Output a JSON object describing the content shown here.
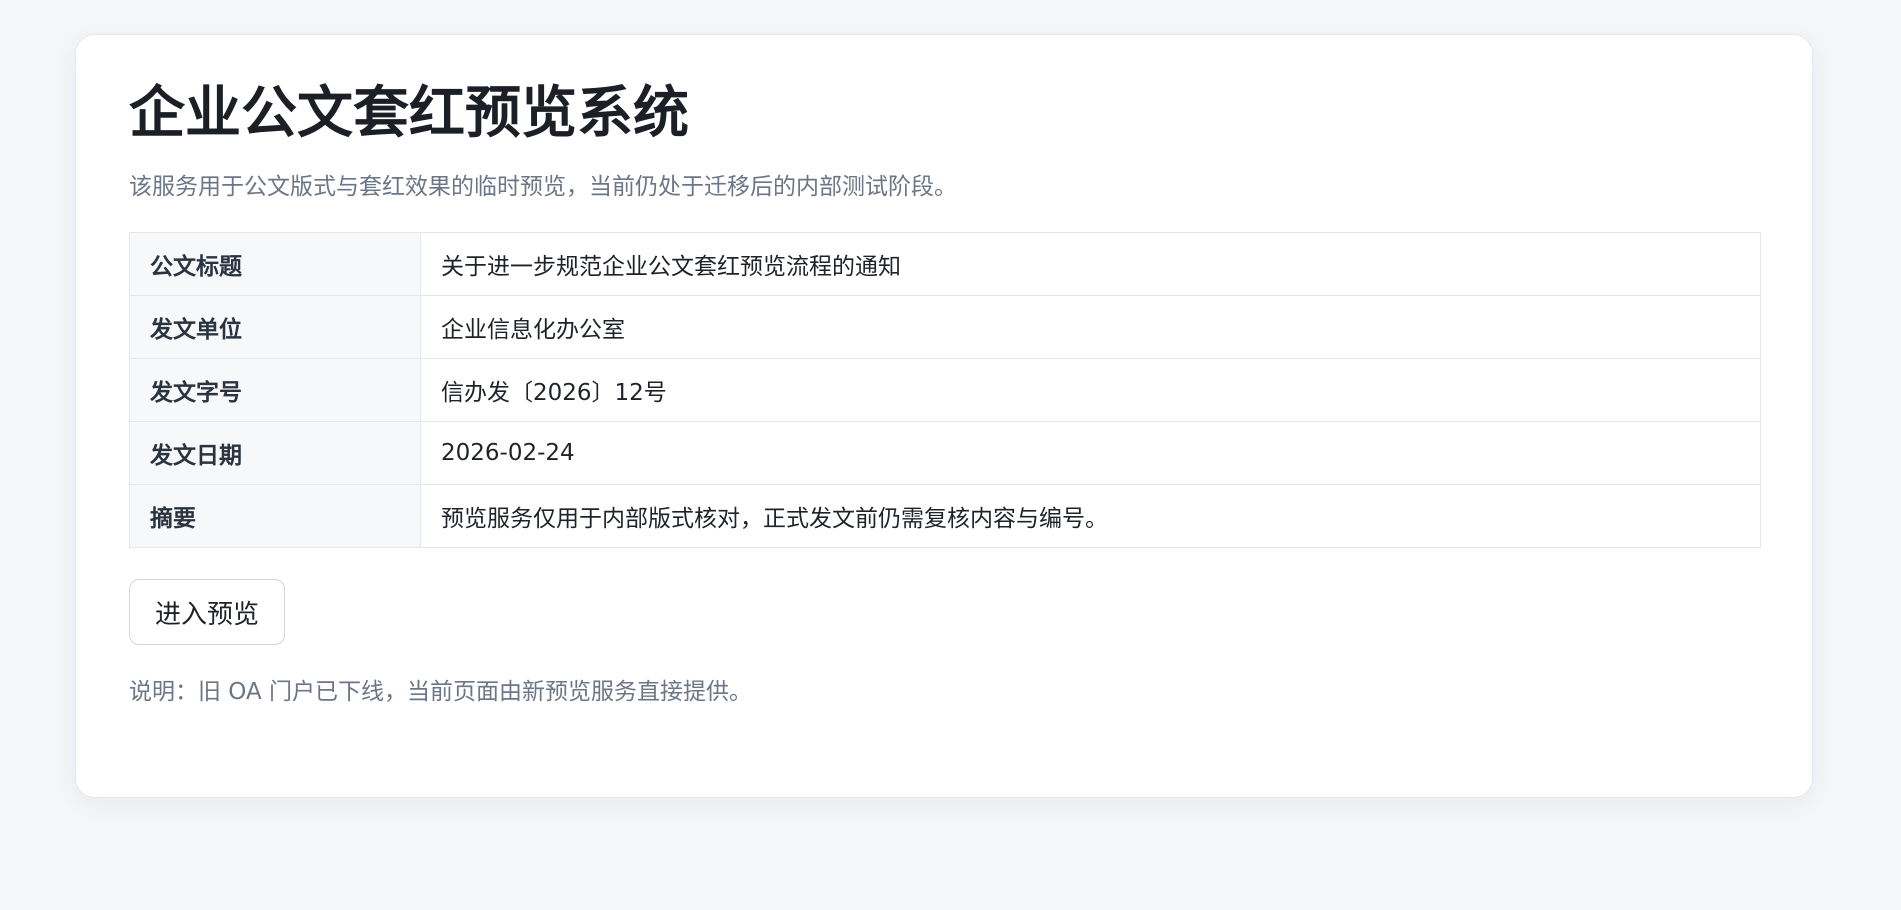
{
  "page": {
    "title": "企业公文套红预览系统",
    "subtitle": "该服务用于公文版式与套红效果的临时预览，当前仍处于迁移后的内部测试阶段。"
  },
  "info_table": {
    "rows": [
      {
        "key": "公文标题",
        "value": "关于进一步规范企业公文套红预览流程的通知"
      },
      {
        "key": "发文单位",
        "value": "企业信息化办公室"
      },
      {
        "key": "发文字号",
        "value": "信办发〔2026〕12号"
      },
      {
        "key": "发文日期",
        "value": "2026-02-24"
      },
      {
        "key": "摘要",
        "value": "预览服务仅用于内部版式核对，正式发文前仍需复核内容与编号。"
      }
    ]
  },
  "actions": {
    "preview_label": "进入预览"
  },
  "footer": {
    "note": "说明：旧 OA 门户已下线，当前页面由新预览服务直接提供。"
  },
  "colors": {
    "background": "#f5f6f8",
    "card": "#ffffff",
    "title_text": "#1c1f26",
    "muted_text": "#6b7686",
    "table_key_bg": "#f7f8fa",
    "border": "#e4e7ec"
  }
}
